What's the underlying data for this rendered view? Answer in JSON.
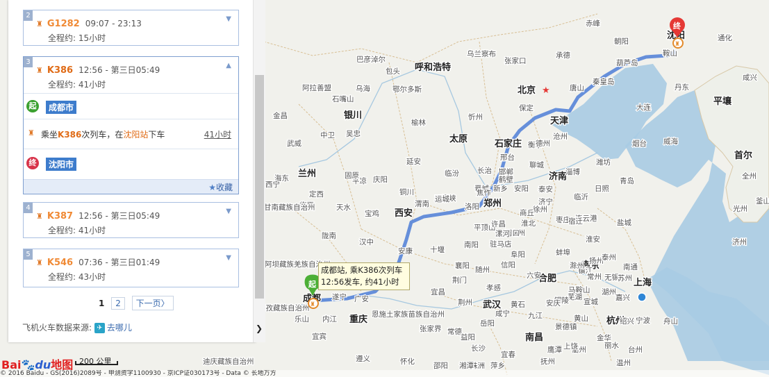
{
  "panel": {
    "results": [
      {
        "index": "2",
        "code": "G1282",
        "times": "09:07 - 23:13",
        "duration": "全程约: 15小时",
        "expanded": false
      },
      {
        "index": "3",
        "code": "K386",
        "times": "12:56 - 第三日05:49",
        "duration": "全程约: 41小时",
        "expanded": true
      },
      {
        "index": "4",
        "code": "K387",
        "times": "12:56 - 第三日05:49",
        "duration": "全程约: 41小时",
        "expanded": false
      },
      {
        "index": "5",
        "code": "K546",
        "times": "07:36 - 第三日01:49",
        "duration": "全程约: 43小时",
        "expanded": false
      }
    ],
    "detail": {
      "start_badge": "起",
      "start_city": "成都市",
      "ride_prefix": "乘坐",
      "ride_train": "K386",
      "ride_mid": "次列车，在",
      "ride_station": "沈阳站",
      "ride_suffix": "下车",
      "ride_duration": "41小时",
      "end_badge": "终",
      "end_city": "沈阳市",
      "favorite": "收藏"
    },
    "pager": {
      "current": "1",
      "page2": "2",
      "next": "下一页〉"
    },
    "source_label": "飞机火车数据来源:",
    "source_name": "去哪儿"
  },
  "map": {
    "tooltip_line1": "成都站, 乘K386次列车",
    "tooltip_line2": "12:56发车, 约41小时",
    "start_marker": "起",
    "end_marker": "终",
    "scale_label": "200 公里",
    "logo_bai": "Bai",
    "logo_du": "du",
    "logo_map": "地图",
    "copyright": "© 2016 Baidu - GS(2016)2089号 - 甲测资字1100930 - 京ICP证030173号 - Data © 长地万方",
    "route_color": "#5a87d8",
    "labels": [
      {
        "t": "北京",
        "bold": true
      },
      {
        "t": "天津",
        "bold": true
      },
      {
        "t": "石家庄",
        "bold": true
      },
      {
        "t": "太原",
        "bold": true
      },
      {
        "t": "郑州",
        "bold": true
      },
      {
        "t": "西安",
        "bold": true
      },
      {
        "t": "济南",
        "bold": true
      },
      {
        "t": "合肥",
        "bold": true
      },
      {
        "t": "南京",
        "bold": true
      },
      {
        "t": "上海",
        "bold": true
      },
      {
        "t": "杭州",
        "bold": true
      },
      {
        "t": "武汉",
        "bold": true
      },
      {
        "t": "南昌",
        "bold": true
      },
      {
        "t": "长沙",
        "bold": false
      },
      {
        "t": "重庆",
        "bold": true
      },
      {
        "t": "兰州",
        "bold": true
      },
      {
        "t": "银川",
        "bold": true
      },
      {
        "t": "呼和浩特",
        "bold": true
      },
      {
        "t": "首尔",
        "bold": true
      },
      {
        "t": "平壤",
        "bold": true
      },
      {
        "t": "成都",
        "bold": true
      },
      {
        "t": "沈阳",
        "bold": true
      },
      {
        "t": "赤峰"
      },
      {
        "t": "朝阳"
      },
      {
        "t": "葫芦岛"
      },
      {
        "t": "鞍山"
      },
      {
        "t": "通化"
      },
      {
        "t": "丹东"
      },
      {
        "t": "大连"
      },
      {
        "t": "秦皇岛"
      },
      {
        "t": "唐山"
      },
      {
        "t": "承德"
      },
      {
        "t": "张家口"
      },
      {
        "t": "乌兰察布"
      },
      {
        "t": "包头"
      },
      {
        "t": "巴彦淖尔"
      },
      {
        "t": "鄂尔多斯"
      },
      {
        "t": "乌海"
      },
      {
        "t": "阿拉善盟"
      },
      {
        "t": "石嘴山"
      },
      {
        "t": "吴忠"
      },
      {
        "t": "中卫"
      },
      {
        "t": "榆林"
      },
      {
        "t": "忻州"
      },
      {
        "t": "保定"
      },
      {
        "t": "沧州"
      },
      {
        "t": "衡水"
      },
      {
        "t": "德州"
      },
      {
        "t": "邢台"
      },
      {
        "t": "邯郸"
      },
      {
        "t": "聊城"
      },
      {
        "t": "泰安"
      },
      {
        "t": "淄博"
      },
      {
        "t": "潍坊"
      },
      {
        "t": "烟台"
      },
      {
        "t": "威海"
      },
      {
        "t": "青岛"
      },
      {
        "t": "日照"
      },
      {
        "t": "临沂"
      },
      {
        "t": "济宁"
      },
      {
        "t": "枣庄"
      },
      {
        "t": "徐州"
      },
      {
        "t": "连云港"
      },
      {
        "t": "宿迁"
      },
      {
        "t": "淮北"
      },
      {
        "t": "淮安"
      },
      {
        "t": "盐城"
      },
      {
        "t": "扬州"
      },
      {
        "t": "泰州"
      },
      {
        "t": "南通"
      },
      {
        "t": "镇江"
      },
      {
        "t": "常州"
      },
      {
        "t": "无锡"
      },
      {
        "t": "苏州"
      },
      {
        "t": "湖州"
      },
      {
        "t": "嘉兴"
      },
      {
        "t": "绍兴"
      },
      {
        "t": "宁波"
      },
      {
        "t": "舟山"
      },
      {
        "t": "金华"
      },
      {
        "t": "衢州"
      },
      {
        "t": "丽水"
      },
      {
        "t": "台州"
      },
      {
        "t": "温州"
      },
      {
        "t": "黄山"
      },
      {
        "t": "宣城"
      },
      {
        "t": "马鞍山"
      },
      {
        "t": "芜湖"
      },
      {
        "t": "铜陵"
      },
      {
        "t": "安庆"
      },
      {
        "t": "六安"
      },
      {
        "t": "滁州"
      },
      {
        "t": "蚌埠"
      },
      {
        "t": "阜阳"
      },
      {
        "t": "亳州"
      },
      {
        "t": "商丘"
      },
      {
        "t": "周口"
      },
      {
        "t": "驻马店"
      },
      {
        "t": "信阳"
      },
      {
        "t": "平顶山"
      },
      {
        "t": "许昌"
      },
      {
        "t": "漯河"
      },
      {
        "t": "南阳"
      },
      {
        "t": "洛阳"
      },
      {
        "t": "三门峡"
      },
      {
        "t": "运城"
      },
      {
        "t": "临汾"
      },
      {
        "t": "长治"
      },
      {
        "t": "晋城"
      },
      {
        "t": "安阳"
      },
      {
        "t": "鹤壁"
      },
      {
        "t": "新乡"
      },
      {
        "t": "焦作"
      },
      {
        "t": "延安"
      },
      {
        "t": "铜川"
      },
      {
        "t": "渭南"
      },
      {
        "t": "宝鸡"
      },
      {
        "t": "天水"
      },
      {
        "t": "平凉"
      },
      {
        "t": "庆阳"
      },
      {
        "t": "固原"
      },
      {
        "t": "定西"
      },
      {
        "t": "陇南"
      },
      {
        "t": "汉中"
      },
      {
        "t": "安康"
      },
      {
        "t": "十堰"
      },
      {
        "t": "襄阳"
      },
      {
        "t": "随州"
      },
      {
        "t": "孝感"
      },
      {
        "t": "荆州"
      },
      {
        "t": "荆门"
      },
      {
        "t": "宜昌"
      },
      {
        "t": "恩施土家族苗族自治州"
      },
      {
        "t": "张家界"
      },
      {
        "t": "常德"
      },
      {
        "t": "益阳"
      },
      {
        "t": "岳阳"
      },
      {
        "t": "咸宁"
      },
      {
        "t": "黄石"
      },
      {
        "t": "九江"
      },
      {
        "t": "景德镇"
      },
      {
        "t": "上饶"
      },
      {
        "t": "鹰潭"
      },
      {
        "t": "抚州"
      },
      {
        "t": "宜春"
      },
      {
        "t": "萍乡"
      },
      {
        "t": "株洲"
      },
      {
        "t": "湘潭"
      },
      {
        "t": "邵阳"
      },
      {
        "t": "怀化"
      },
      {
        "t": "遵义"
      },
      {
        "t": "宜宾"
      },
      {
        "t": "乐山"
      },
      {
        "t": "内江"
      },
      {
        "t": "达州"
      },
      {
        "t": "广安"
      },
      {
        "t": "遂宁"
      },
      {
        "t": "阿坝藏族羌族自治州"
      },
      {
        "t": "甘孜藏族自治州"
      },
      {
        "t": "迪庆藏族自治州"
      },
      {
        "t": "金昌"
      },
      {
        "t": "武威"
      },
      {
        "t": "临夏"
      },
      {
        "t": "甘南藏族自治州"
      },
      {
        "t": "海东"
      },
      {
        "t": "西宁"
      },
      {
        "t": "咸兴"
      },
      {
        "t": "光州"
      },
      {
        "t": "全州"
      },
      {
        "t": "釜山"
      },
      {
        "t": "济州"
      }
    ]
  }
}
